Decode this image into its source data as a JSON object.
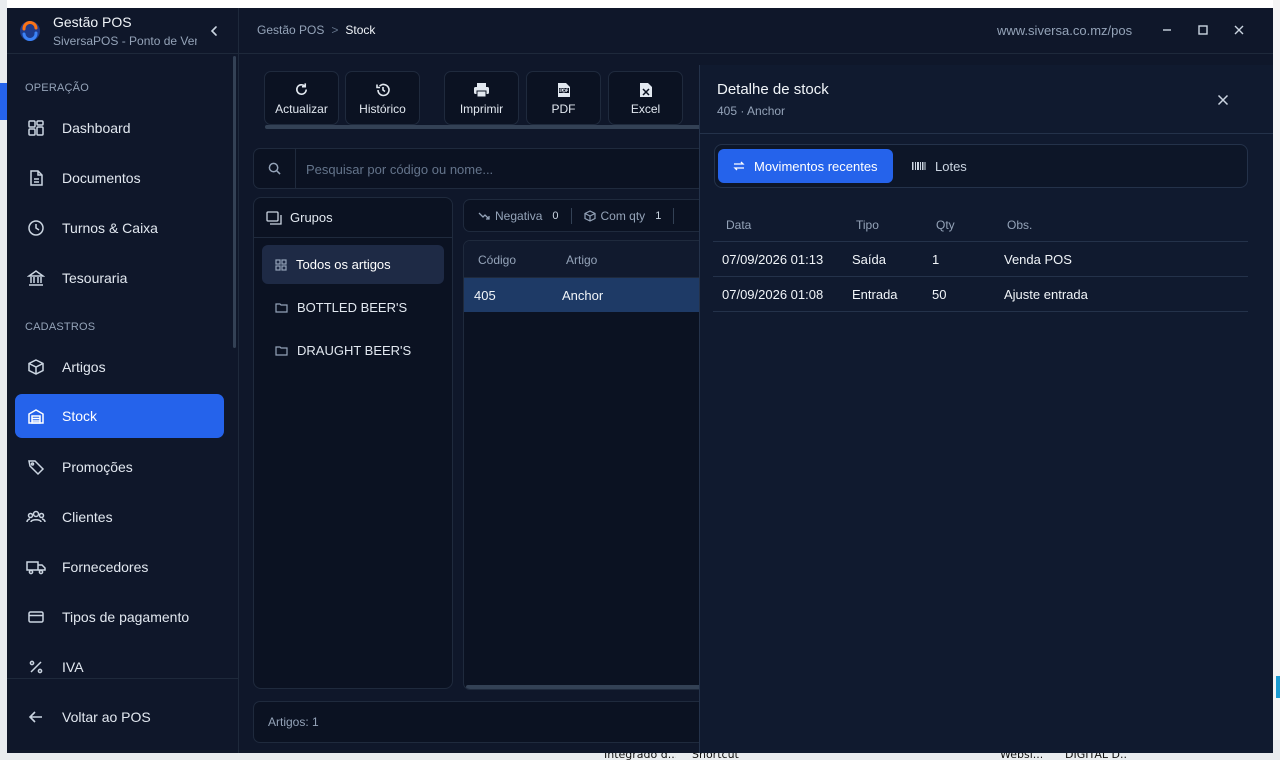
{
  "brand": {
    "title": "Gestão POS",
    "subtitle": "SiversaPOS - Ponto de Venda"
  },
  "header": {
    "breadcrumb_root": "Gestão POS",
    "breadcrumb_sep": ">",
    "breadcrumb_current": "Stock",
    "url": "www.siversa.co.mz/pos"
  },
  "sidebar": {
    "sections": [
      {
        "label": "OPERAÇÃO"
      },
      {
        "label": "CADASTROS"
      }
    ],
    "items": [
      {
        "label": "Dashboard",
        "icon": "dashboard-icon"
      },
      {
        "label": "Documentos",
        "icon": "document-icon"
      },
      {
        "label": "Turnos & Caixa",
        "icon": "clock-icon"
      },
      {
        "label": "Tesouraria",
        "icon": "bank-icon"
      },
      {
        "label": "Artigos",
        "icon": "box-icon"
      },
      {
        "label": "Stock",
        "icon": "warehouse-icon",
        "active": true
      },
      {
        "label": "Promoções",
        "icon": "tag-icon"
      },
      {
        "label": "Clientes",
        "icon": "users-icon"
      },
      {
        "label": "Fornecedores",
        "icon": "truck-icon"
      },
      {
        "label": "Tipos de pagamento",
        "icon": "card-icon"
      },
      {
        "label": "IVA",
        "icon": "percent-icon"
      }
    ],
    "back_label": "Voltar ao POS"
  },
  "toolbar": {
    "buttons": [
      {
        "label": "Actualizar",
        "icon": "refresh-icon"
      },
      {
        "label": "Histórico",
        "icon": "history-icon"
      },
      {
        "label": "Imprimir",
        "icon": "printer-icon"
      },
      {
        "label": "PDF",
        "icon": "pdf-icon"
      },
      {
        "label": "Excel",
        "icon": "excel-icon"
      }
    ]
  },
  "search": {
    "placeholder": "Pesquisar por código ou nome...",
    "value": ""
  },
  "groups": {
    "title": "Grupos",
    "items": [
      {
        "label": "Todos os artigos",
        "active": true
      },
      {
        "label": "BOTTLED BEER'S"
      },
      {
        "label": "DRAUGHT BEER'S"
      }
    ]
  },
  "filters": [
    {
      "label": "Negativa",
      "count": "0"
    },
    {
      "label": "Com qty",
      "count": "1"
    }
  ],
  "table": {
    "columns": [
      "Código",
      "Artigo"
    ],
    "rows": [
      {
        "codigo": "405",
        "artigo": "Anchor"
      }
    ]
  },
  "footer": {
    "count_label": "Artigos: 1"
  },
  "detail": {
    "title": "Detalhe de stock",
    "subtitle": "405 · Anchor",
    "tabs": [
      {
        "label": "Movimentos recentes",
        "active": true
      },
      {
        "label": "Lotes"
      }
    ],
    "columns": [
      "Data",
      "Tipo",
      "Qty",
      "Obs."
    ],
    "rows": [
      {
        "data": "07/09/2026 01:13",
        "tipo": "Saída",
        "qty": "1",
        "obs": "Venda POS"
      },
      {
        "data": "07/09/2026 01:08",
        "tipo": "Entrada",
        "qty": "50",
        "obs": "Ajuste entrada"
      }
    ]
  },
  "taskbar": [
    "Integrado d...",
    "Shortcut",
    "Websi...",
    "DIGITAL D..."
  ]
}
